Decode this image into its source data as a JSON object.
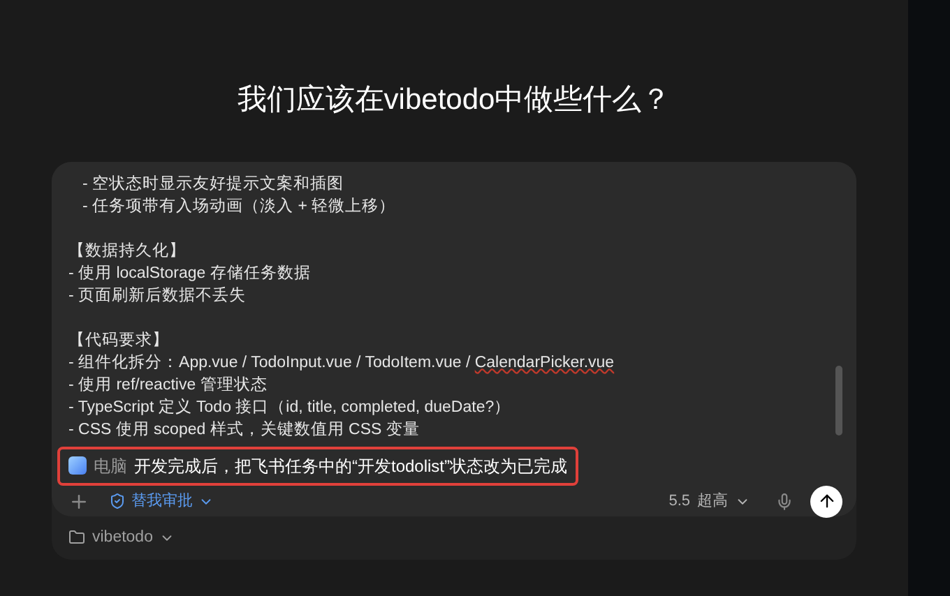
{
  "heading": "我们应该在vibetodo中做些什么？",
  "prompt": {
    "sections": [
      {
        "kind": "nested",
        "lines": [
          {
            "parts": [
              {
                "text": "- 空状态时显示友好提示文案和插图",
                "misspelled": false
              }
            ]
          },
          {
            "parts": [
              {
                "text": "- 任务项带有入场动画（淡入 + 轻微上移）",
                "misspelled": false
              }
            ]
          }
        ]
      },
      {
        "kind": "plain",
        "title": "【数据持久化】",
        "lines": [
          {
            "parts": [
              {
                "text": "- 使用 localStorage 存储任务数据",
                "misspelled": false
              }
            ]
          },
          {
            "parts": [
              {
                "text": "- 页面刷新后数据不丢失",
                "misspelled": false
              }
            ]
          }
        ]
      },
      {
        "kind": "plain",
        "title": "【代码要求】",
        "lines": [
          {
            "parts": [
              {
                "text": "- 组件化拆分：App.vue / TodoInput.vue / TodoItem.vue / ",
                "misspelled": false
              },
              {
                "text": "CalendarPicker.vue",
                "misspelled": true
              }
            ]
          },
          {
            "parts": [
              {
                "text": "- 使用 ref/reactive 管理状态",
                "misspelled": false
              }
            ]
          },
          {
            "parts": [
              {
                "text": "- TypeScript 定义 Todo 接口（id, title, completed, dueDate?）",
                "misspelled": false
              }
            ]
          },
          {
            "parts": [
              {
                "text": "- CSS 使用 scoped 样式，关键数值用 CSS 变量",
                "misspelled": false
              }
            ]
          }
        ]
      }
    ],
    "mention": {
      "label": "电脑",
      "message": "开发完成后，把飞书任务中的“开发todolist”状态改为已完成",
      "highlighted": true
    }
  },
  "toolbar": {
    "approval": "替我审批",
    "model_version": "5.5",
    "effort": "超高"
  },
  "workspace": {
    "folder": "vibetodo"
  }
}
